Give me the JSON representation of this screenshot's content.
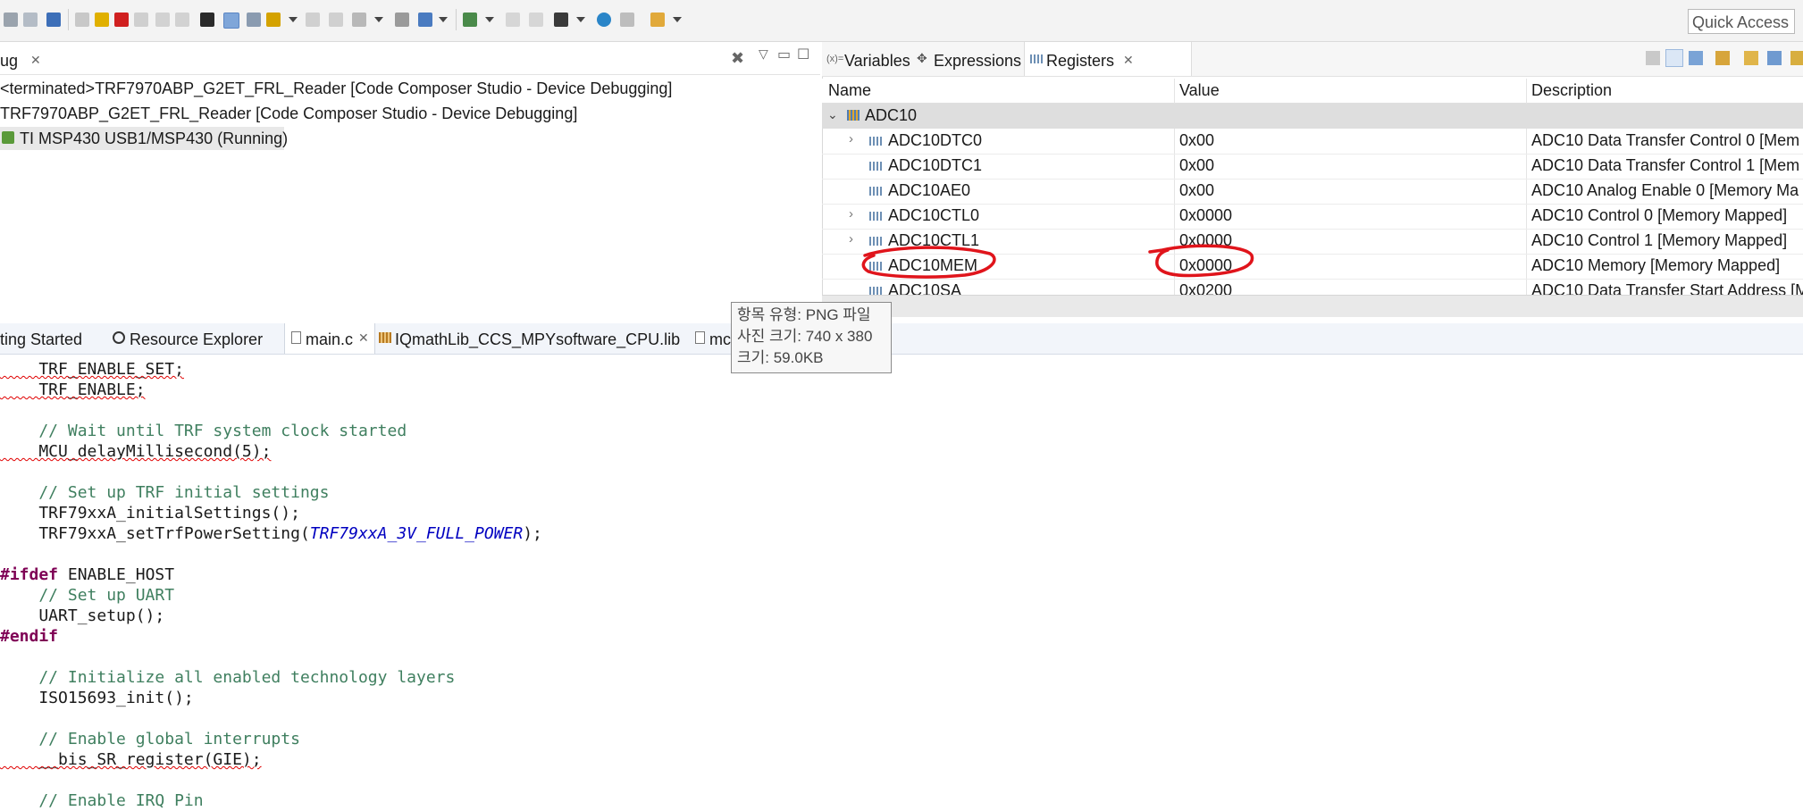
{
  "toolbar": {
    "quick_access": "Quick Access"
  },
  "debug": {
    "tab_label": "ug",
    "items": [
      "<terminated>TRF7970ABP_G2ET_FRL_Reader [Code Composer Studio - Device Debugging]",
      "TRF7970ABP_G2ET_FRL_Reader [Code Composer Studio - Device Debugging]",
      "TI MSP430 USB1/MSP430 (Running)"
    ]
  },
  "registers_view": {
    "tabs": [
      "Variables",
      "Expressions",
      "Registers"
    ],
    "columns": [
      "Name",
      "Value",
      "Description"
    ],
    "group": "ADC10",
    "rows": [
      {
        "name": "ADC10DTC0",
        "value": "0x00",
        "description": "ADC10 Data Transfer Control 0 [Mem"
      },
      {
        "name": "ADC10DTC1",
        "value": "0x00",
        "description": "ADC10 Data Transfer Control 1 [Mem"
      },
      {
        "name": "ADC10AE0",
        "value": "0x00",
        "description": "ADC10 Analog Enable 0 [Memory Ma"
      },
      {
        "name": "ADC10CTL0",
        "value": "0x0000",
        "description": "ADC10 Control 0 [Memory Mapped]"
      },
      {
        "name": "ADC10CTL1",
        "value": "0x0000",
        "description": "ADC10 Control 1 [Memory Mapped]"
      },
      {
        "name": "ADC10MEM",
        "value": "0x0000",
        "description": "ADC10 Memory [Memory Mapped]"
      },
      {
        "name": "ADC10SA",
        "value": "0x0200",
        "description": "ADC10 Data Transfer Start Address [M"
      }
    ]
  },
  "editor": {
    "tabs": [
      "ting Started",
      "Resource Explorer",
      "main.c",
      "IQmathLib_CCS_MPYsoftware_CPU.lib",
      "mc"
    ],
    "code": {
      "l1": "    TRF_ENABLE_SET;",
      "l2": "    TRF_ENABLE;",
      "l3": "    // Wait until TRF system clock started",
      "l4": "    MCU_delayMillisecond(5);",
      "l5": "    // Set up TRF initial settings",
      "l6": "    TRF79xxA_initialSettings();",
      "l7a": "    TRF79xxA_setTrfPowerSetting(",
      "l7b": "TRF79xxA_3V_FULL_POWER",
      "l7c": ");",
      "l8a": "#ifdef",
      "l8b": " ENABLE_HOST",
      "l9": "    // Set up UART",
      "l10": "    UART_setup();",
      "l11": "#endif",
      "l12": "    // Initialize all enabled technology layers",
      "l13": "    ISO15693_init();",
      "l14": "    // Enable global interrupts",
      "l15": "    __bis_SR_register(GIE);",
      "l16": "    // Enable IRQ Pin"
    }
  },
  "tooltip": {
    "line1": "항목 유형: PNG 파일",
    "line2": "사진 크기: 740 x 380",
    "line3": "크기: 59.0KB"
  },
  "colors": {
    "annotation": "#e0141b",
    "keyword": "#7f0055",
    "comment": "#3f7f5f",
    "macro": "#0000c0"
  }
}
